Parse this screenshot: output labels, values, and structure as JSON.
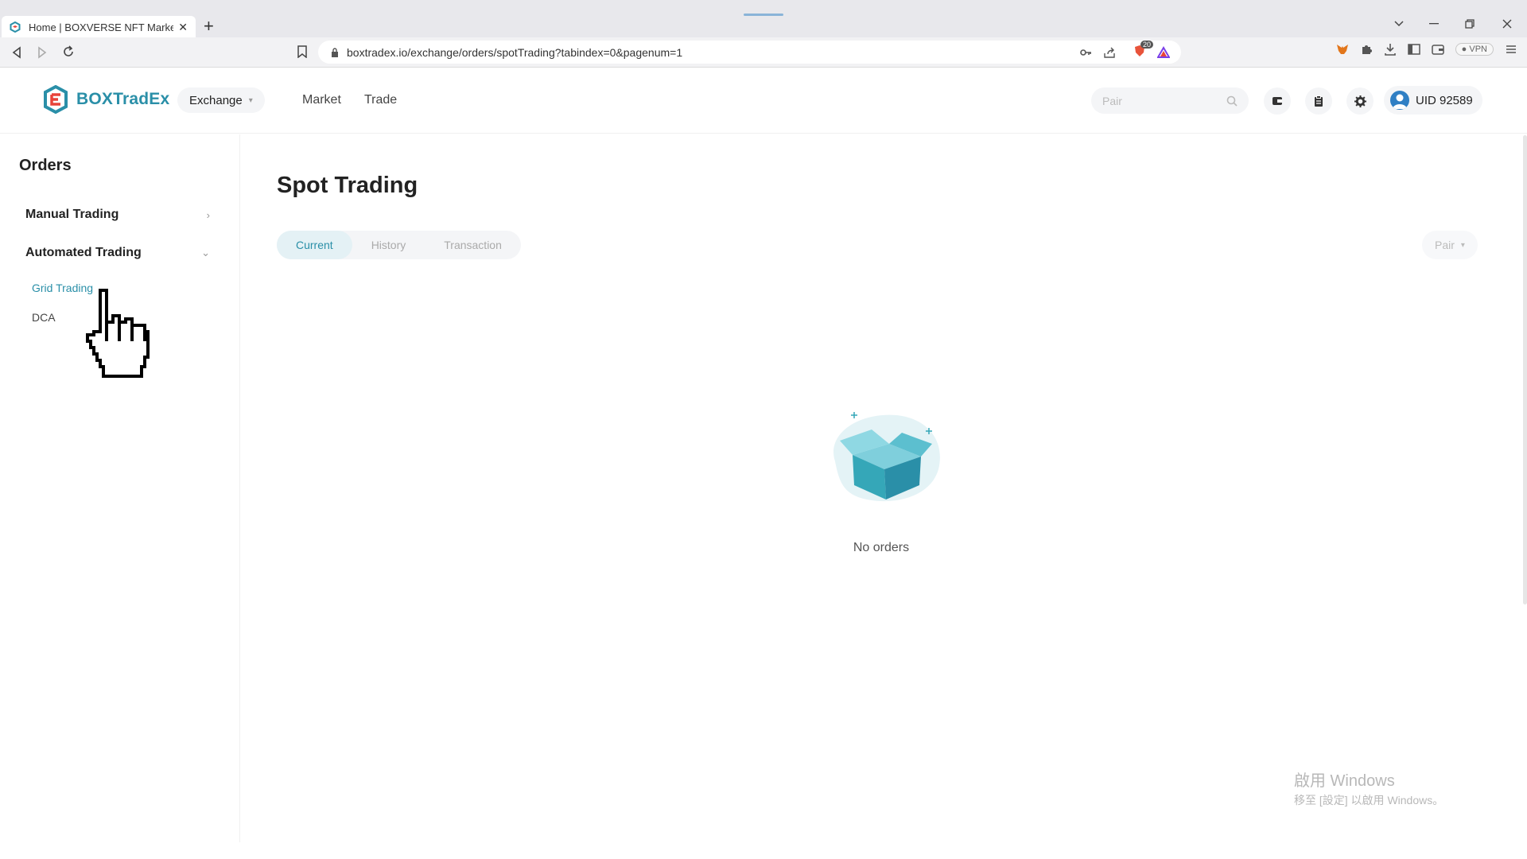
{
  "browser": {
    "tab_title": "Home | BOXVERSE NFT Marketp",
    "tab_close": "✕",
    "new_tab": "+",
    "url": "boxtradex.io/exchange/orders/spotTrading?tabindex=0&pagenum=1",
    "vpn_label": "VPN",
    "badge_count": "20"
  },
  "header": {
    "logo_text": "BOXTradEx",
    "exchange_label": "Exchange",
    "nav": [
      "Market",
      "Trade"
    ],
    "search_placeholder": "Pair",
    "uid_label": "UID 92589"
  },
  "sidebar": {
    "title": "Orders",
    "groups": [
      {
        "label": "Manual Trading",
        "expanded": false
      },
      {
        "label": "Automated Trading",
        "expanded": true
      }
    ],
    "subitems": [
      {
        "label": "Grid Trading",
        "active": true
      },
      {
        "label": "DCA",
        "active": false
      }
    ]
  },
  "main": {
    "title": "Spot Trading",
    "tabs": [
      {
        "label": "Current",
        "active": true
      },
      {
        "label": "History",
        "active": false
      },
      {
        "label": "Transaction",
        "active": false
      }
    ],
    "pair_filter": "Pair",
    "empty_text": "No orders"
  },
  "watermark": {
    "line1": "啟用 Windows",
    "line2": "移至 [設定] 以啟用 Windows。"
  },
  "colors": {
    "accent": "#2a8fa8",
    "logo_red": "#e8433a",
    "box_teal": "#35a7b8"
  }
}
